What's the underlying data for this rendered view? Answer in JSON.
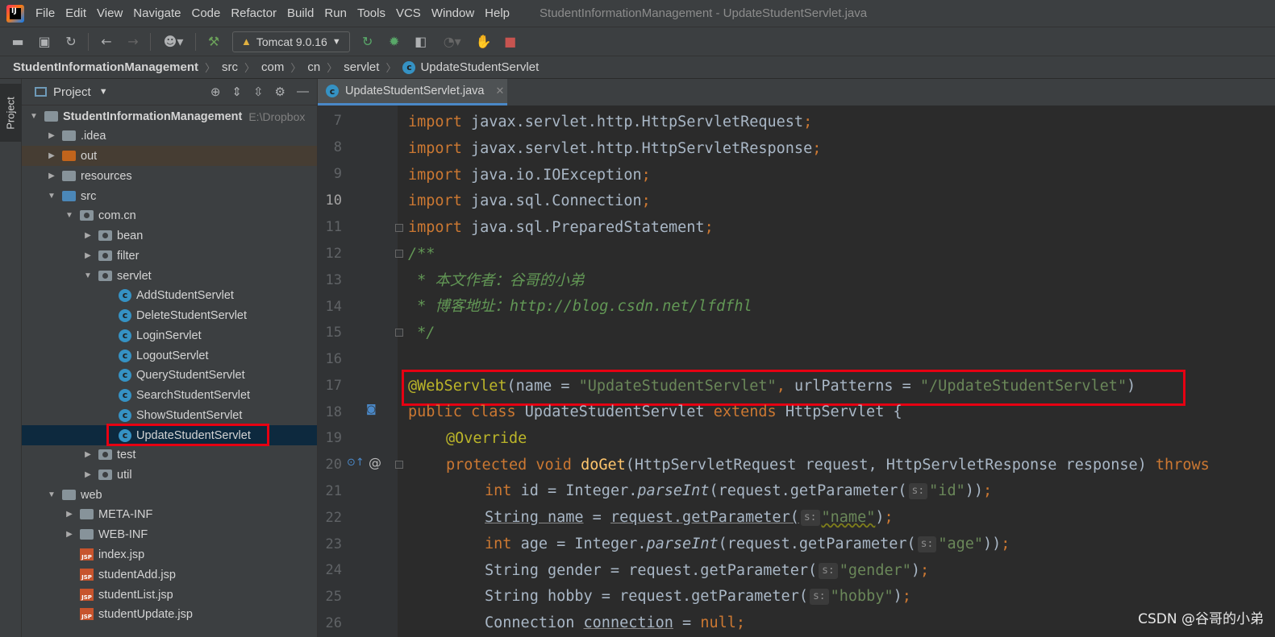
{
  "menubar": {
    "items": [
      "File",
      "Edit",
      "View",
      "Navigate",
      "Code",
      "Refactor",
      "Build",
      "Run",
      "Tools",
      "VCS",
      "Window",
      "Help"
    ],
    "title": "StudentInformationManagement - UpdateStudentServlet.java"
  },
  "toolbar": {
    "run_config": "Tomcat 9.0.16"
  },
  "breadcrumb": [
    "StudentInformationManagement",
    "src",
    "com",
    "cn",
    "servlet",
    "UpdateStudentServlet"
  ],
  "left_strip": {
    "tab": "Project"
  },
  "project": {
    "header": "Project",
    "root": {
      "label": "StudentInformationManagement",
      "path": "E:\\Dropbox"
    },
    "items": {
      "idea": ".idea",
      "out": "out",
      "resources": "resources",
      "src": "src",
      "comcn": "com.cn",
      "bean": "bean",
      "filter": "filter",
      "servlet": "servlet",
      "add": "AddStudentServlet",
      "delete": "DeleteStudentServlet",
      "login": "LoginServlet",
      "logout": "LogoutServlet",
      "query": "QueryStudentServlet",
      "search": "SearchStudentServlet",
      "show": "ShowStudentServlet",
      "update": "UpdateStudentServlet",
      "test": "test",
      "util": "util",
      "web": "web",
      "metainf": "META-INF",
      "webinf": "WEB-INF",
      "index": "index.jsp",
      "studentadd": "studentAdd.jsp",
      "studentlist": "studentList.jsp",
      "studentupdate": "studentUpdate.jsp"
    }
  },
  "editor": {
    "tab": "UpdateStudentServlet.java",
    "line_numbers": [
      "7",
      "8",
      "9",
      "10",
      "11",
      "12",
      "13",
      "14",
      "15",
      "16",
      "17",
      "18",
      "19",
      "20",
      "21",
      "22",
      "23",
      "24",
      "25",
      "26"
    ],
    "current_line": "10"
  },
  "code": {
    "l7_pkg": "javax.servlet.http.HttpServletRequest",
    "l8_pkg": "javax.servlet.http.HttpServletResponse",
    "l9_pkg": "java.io.IOException",
    "l10_pkg": "java.sql.Connection",
    "l11_pkg": "java.sql.PreparedStatement",
    "l12": "/**",
    "l13": " * 本文作者：谷哥的小弟",
    "l14": " * 博客地址：http://blog.csdn.net/lfdfhl",
    "l15": " */",
    "l17_ann": "@WebServlet",
    "l17_name": "\"UpdateStudentServlet\"",
    "l17_url": "\"/UpdateStudentServlet\"",
    "l18_cls": "UpdateStudentServlet",
    "l18_super": "HttpServlet",
    "l19": "@Override",
    "l20_fn": "doGet",
    "l20_params": "(HttpServletRequest request, HttpServletResponse response) ",
    "l20_throws": "throws",
    "hint": "s:",
    "l21_arg": "\"id\"",
    "l22_arg": "\"name\"",
    "l23_arg": "\"age\"",
    "l24_arg": "\"gender\"",
    "l25_arg": "\"hobby\""
  },
  "watermark": "CSDN @谷哥的小弟",
  "colors": {
    "highlight_box": "#e60012",
    "selection": "#0d293e",
    "accent": "#4a88c7"
  }
}
